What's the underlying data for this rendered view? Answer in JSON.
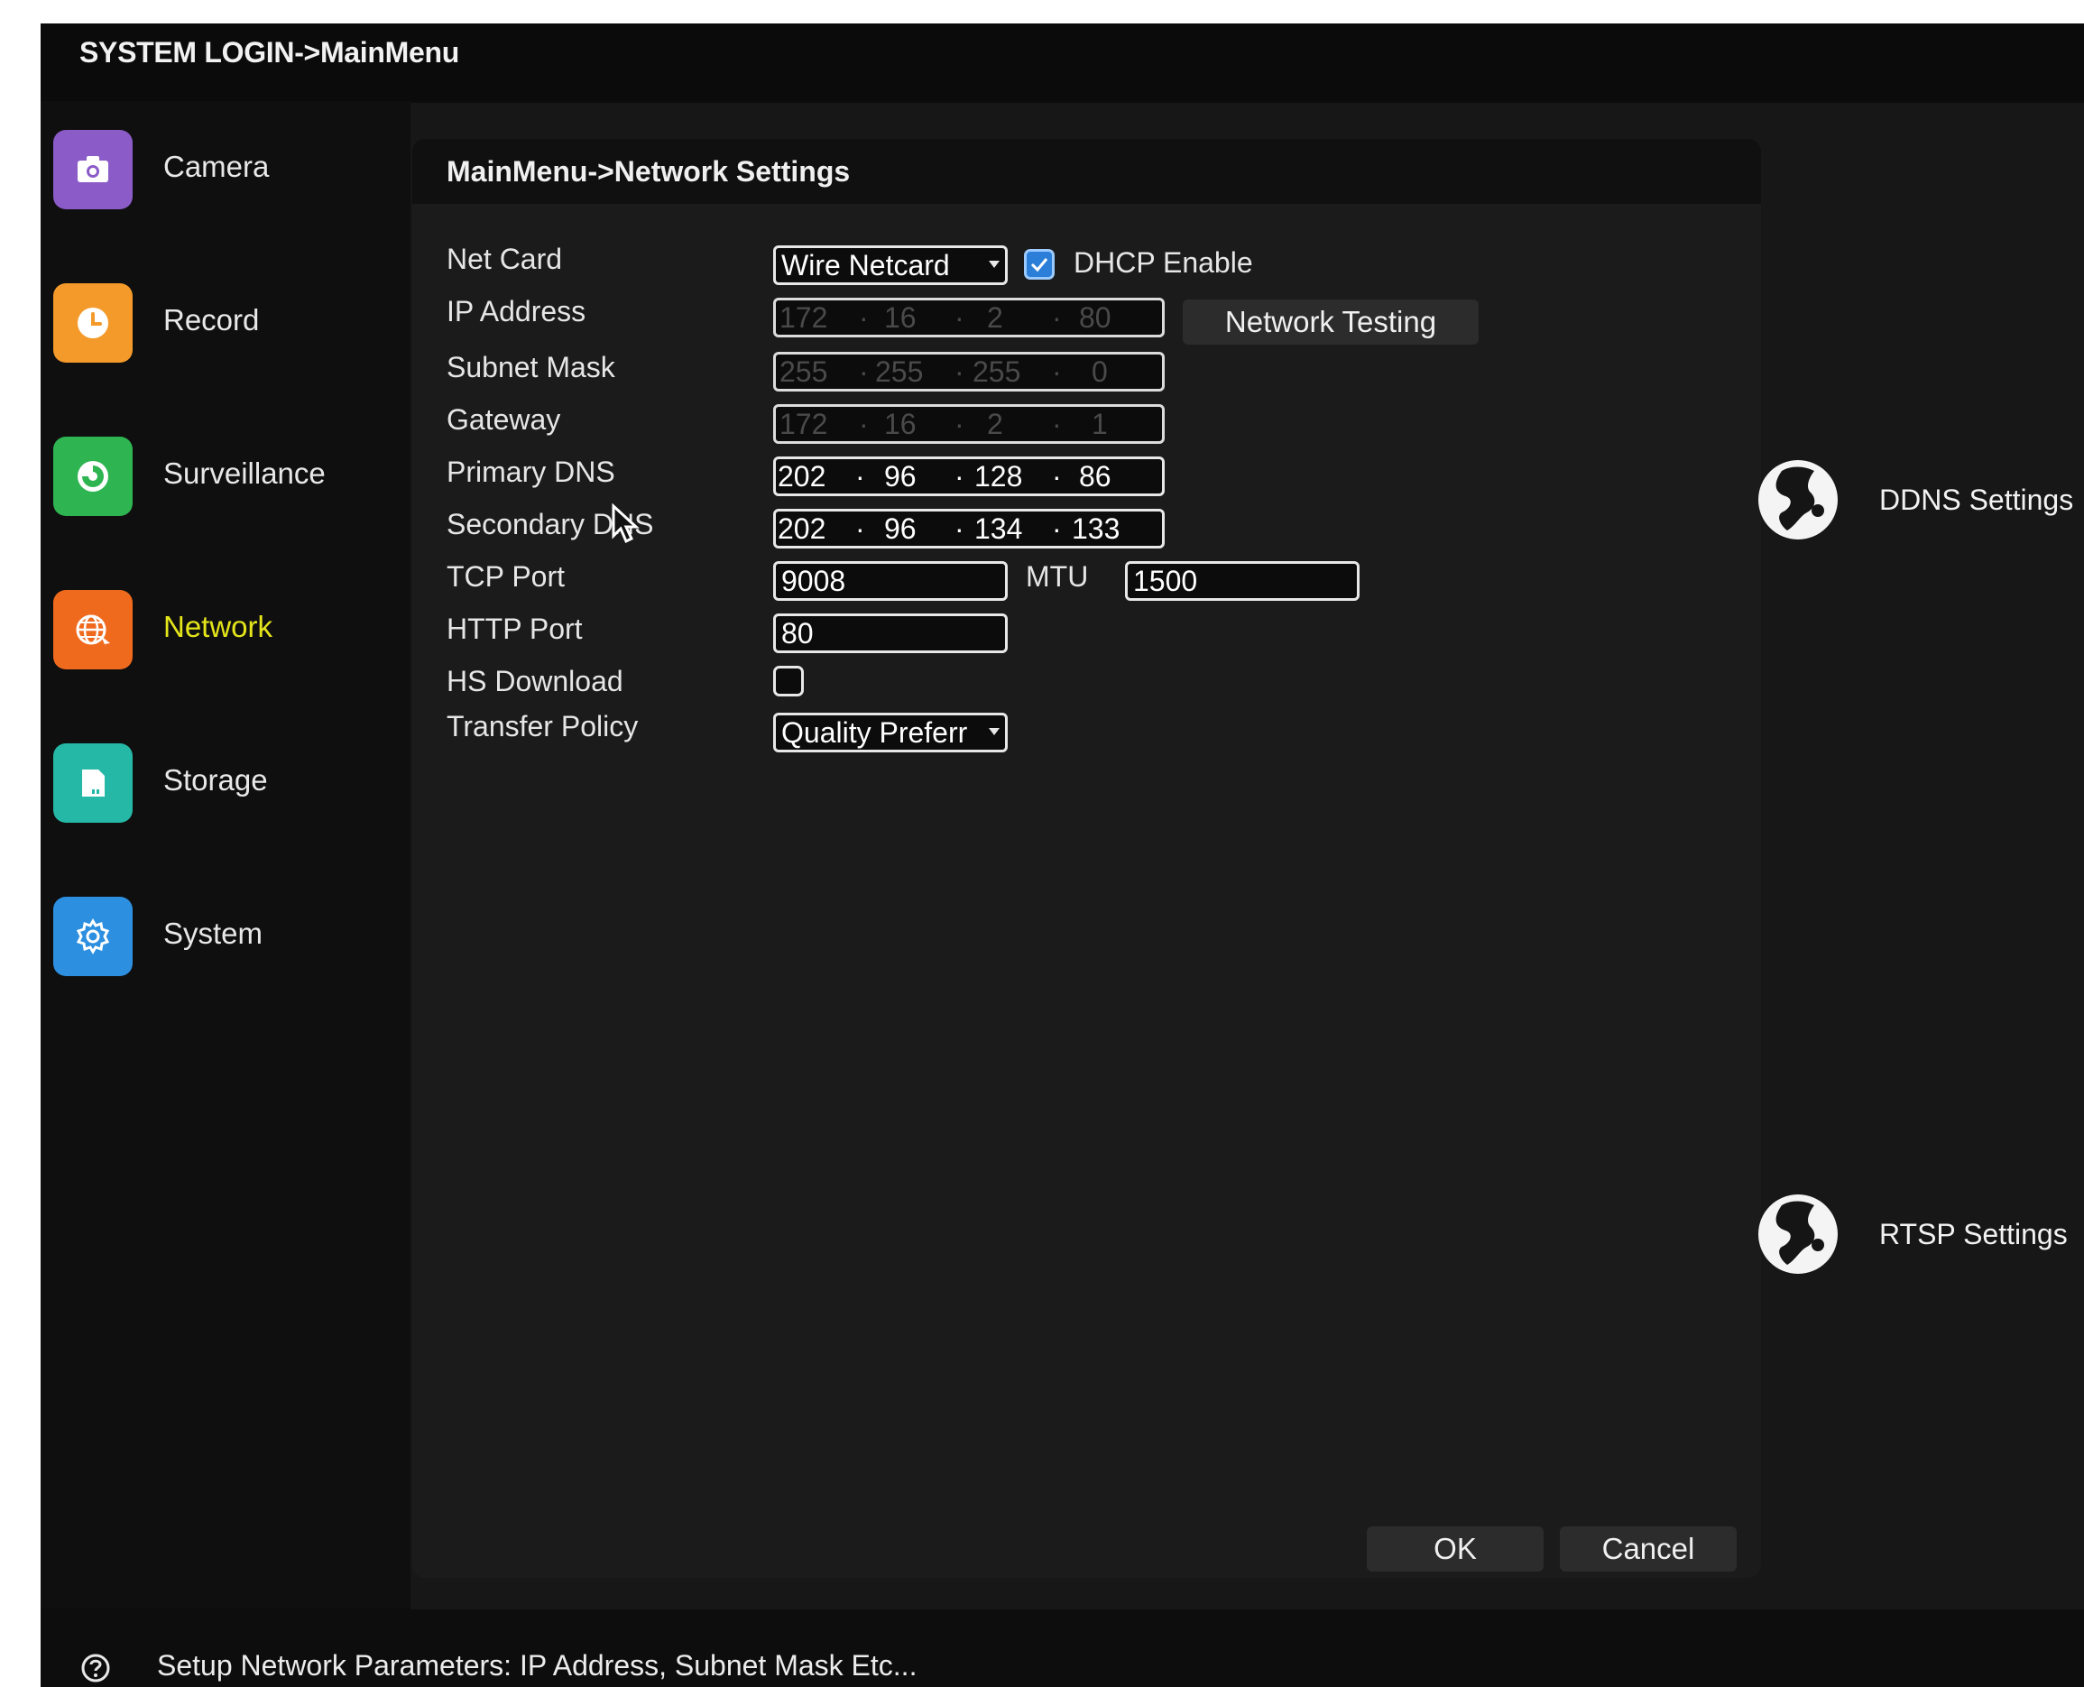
{
  "window": {
    "title": "SYSTEM LOGIN->MainMenu"
  },
  "sidebar": {
    "items": [
      {
        "label": "Camera",
        "icon": "camera-icon",
        "color": "#8b5cc7"
      },
      {
        "label": "Record",
        "icon": "clock-icon",
        "color": "#f39a2a"
      },
      {
        "label": "Surveillance",
        "icon": "surveillance-icon",
        "color": "#2eb552"
      },
      {
        "label": "Network",
        "icon": "network-globe-icon",
        "color": "#f06a1e",
        "active": true
      },
      {
        "label": "Storage",
        "icon": "storage-icon",
        "color": "#25b8a6"
      },
      {
        "label": "System",
        "icon": "gear-icon",
        "color": "#2d8fe0"
      }
    ],
    "active_color": "#e4e51a"
  },
  "dialog": {
    "title": "MainMenu->Network Settings",
    "labels": {
      "net_card": "Net Card",
      "ip_address": "IP Address",
      "subnet_mask": "Subnet Mask",
      "gateway": "Gateway",
      "primary_dns": "Primary DNS",
      "secondary_dns": "Secondary DNS",
      "tcp_port": "TCP Port",
      "mtu": "MTU",
      "http_port": "HTTP Port",
      "hs_download": "HS Download",
      "transfer_policy": "Transfer Policy",
      "dhcp_enable": "DHCP Enable"
    },
    "net_card_value": "Wire Netcard",
    "dhcp_enabled": true,
    "ip_address": [
      "172",
      "16",
      "2",
      "80"
    ],
    "subnet_mask": [
      "255",
      "255",
      "255",
      "0"
    ],
    "gateway": [
      "172",
      "16",
      "2",
      "1"
    ],
    "primary_dns": [
      "202",
      "96",
      "128",
      "86"
    ],
    "secondary_dns": [
      "202",
      "96",
      "134",
      "133"
    ],
    "ip_separator": "·",
    "tcp_port": "9008",
    "mtu": "1500",
    "http_port": "80",
    "hs_download": false,
    "transfer_policy_value": "Quality Preferr",
    "buttons": {
      "network_testing": "Network Testing",
      "ok": "OK",
      "cancel": "Cancel"
    }
  },
  "side_links": {
    "ddns": "DDNS Settings",
    "rtsp": "RTSP Settings"
  },
  "status": {
    "help_text": "Setup Network Parameters: IP Address, Subnet Mask Etc..."
  }
}
